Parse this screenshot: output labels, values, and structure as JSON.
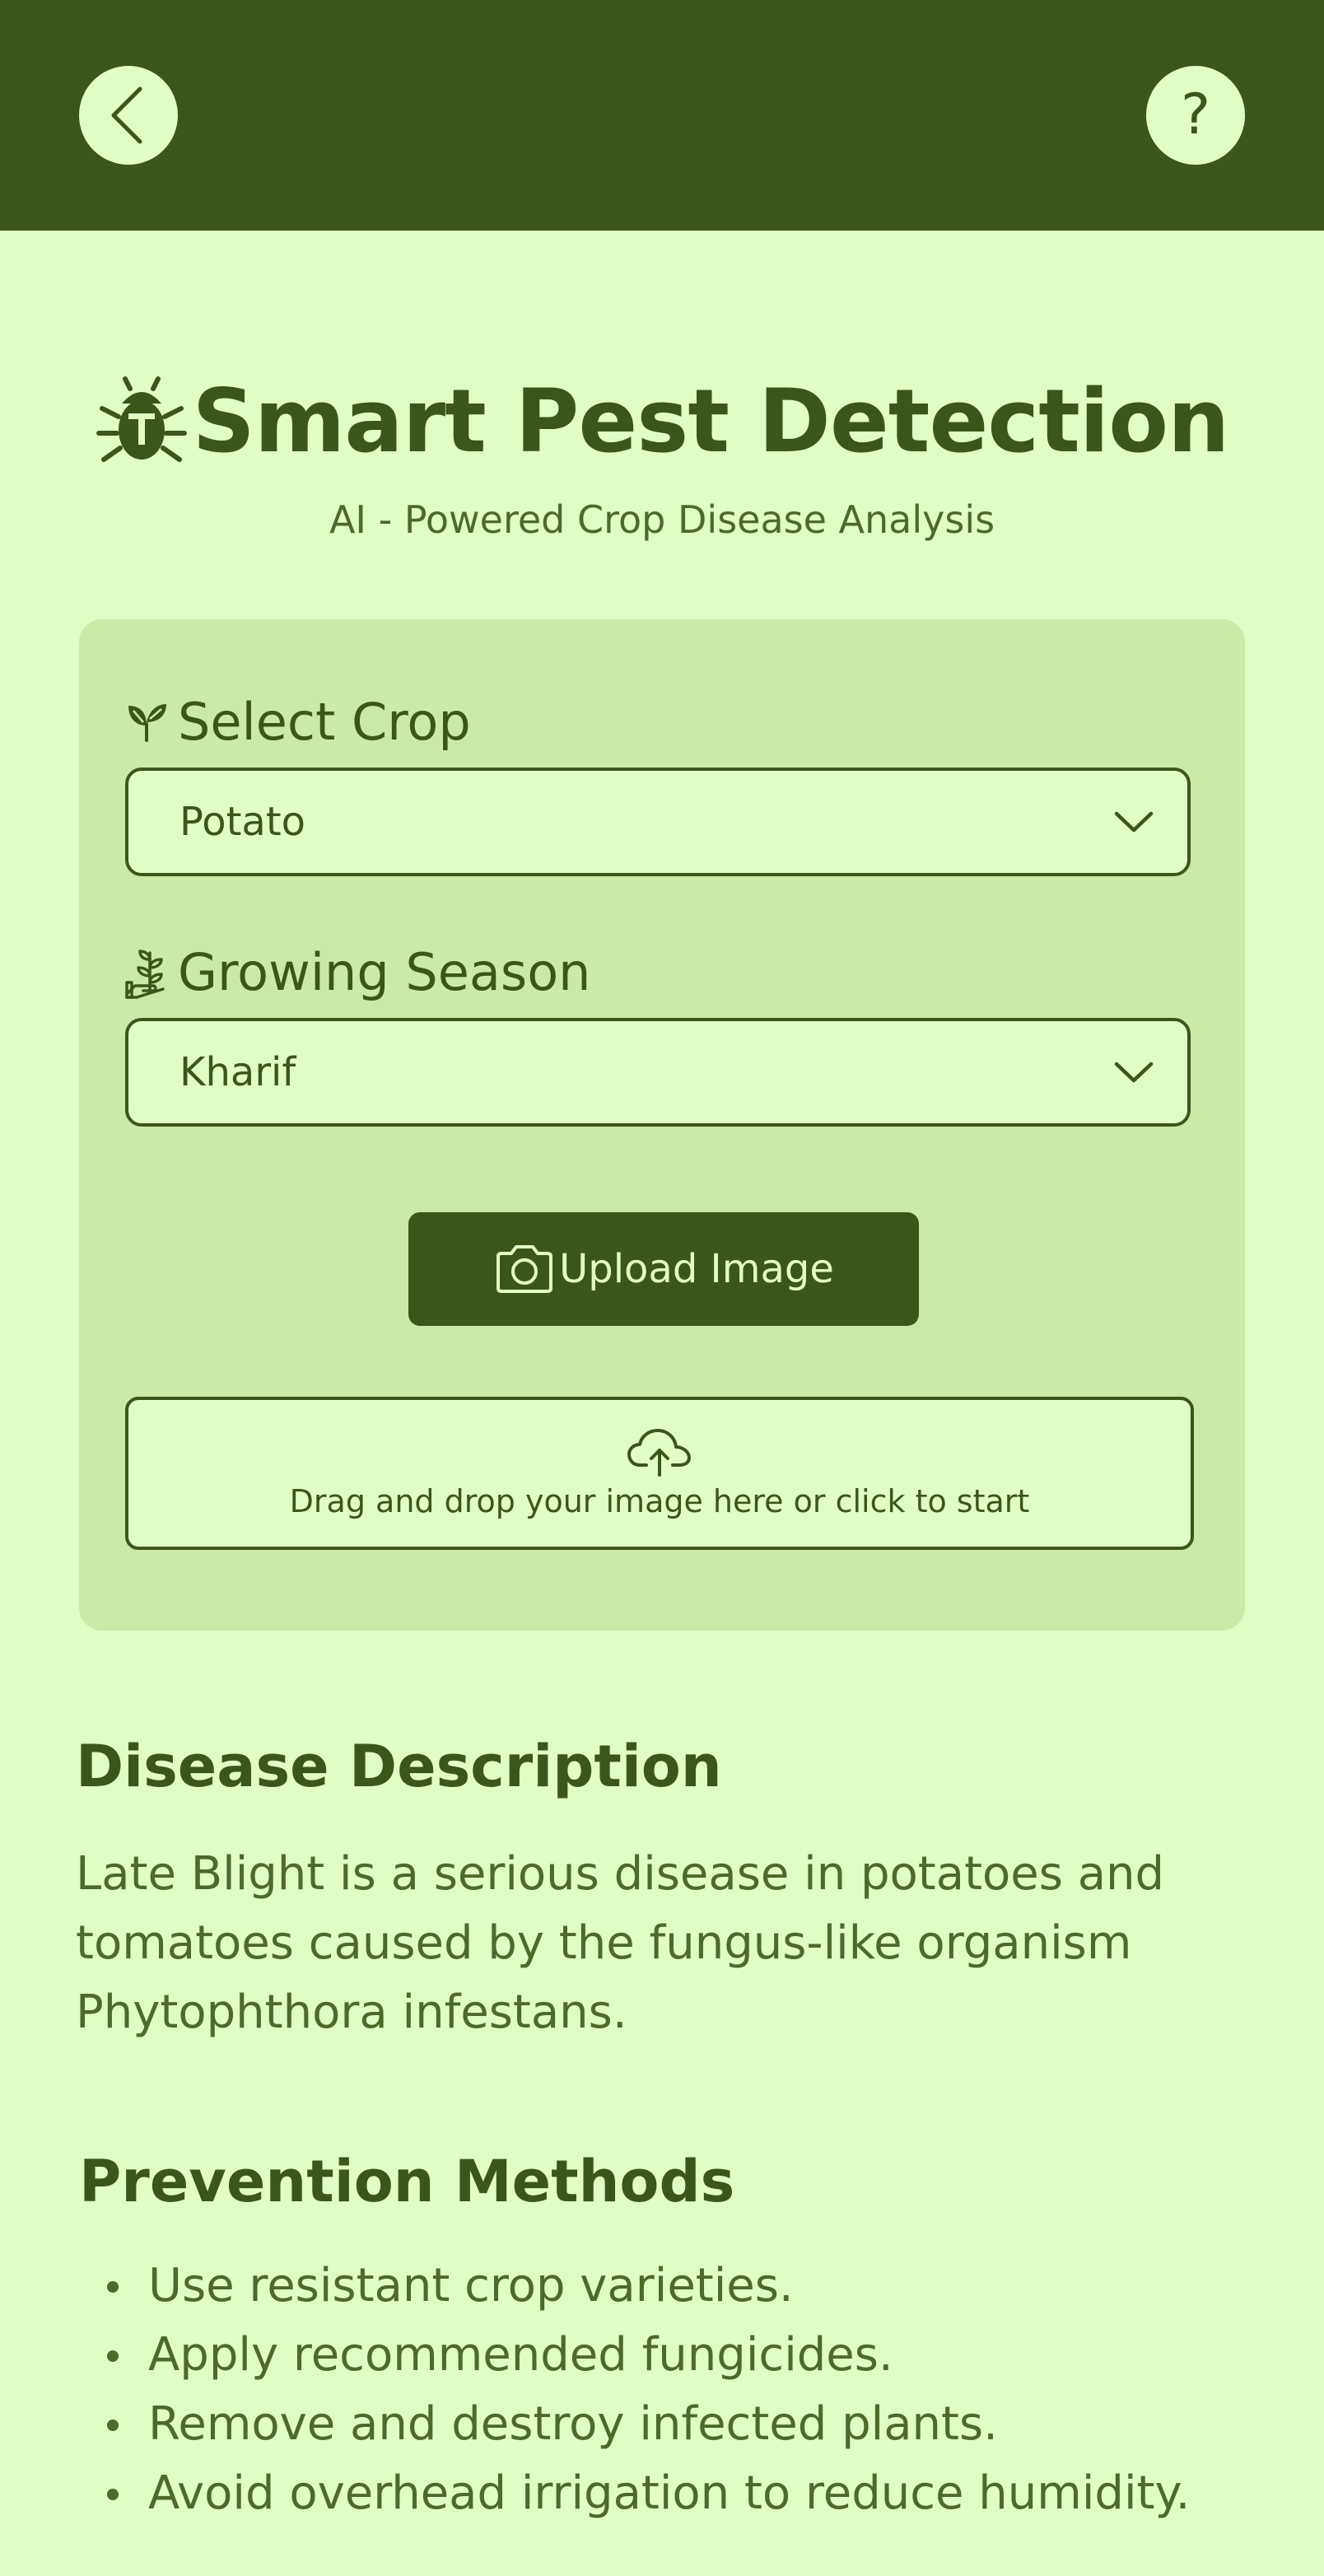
{
  "header": {
    "back_icon": "chevron-left-icon",
    "help_icon": "question-mark-icon",
    "help_glyph": "?"
  },
  "hero": {
    "icon": "bug-icon",
    "title": "Smart Pest Detection",
    "subtitle": "AI - Powered Crop Disease Analysis"
  },
  "form": {
    "crop": {
      "icon": "sprout-icon",
      "label": "Select Crop",
      "value": "Potato"
    },
    "season": {
      "icon": "plant-growth-icon",
      "label": "Growing Season",
      "value": "Kharif"
    },
    "upload_button": {
      "icon": "camera-icon",
      "label": "Upload Image"
    },
    "dropzone": {
      "icon": "cloud-upload-icon",
      "text": "Drag and drop your image here or click to start"
    }
  },
  "disease": {
    "heading": "Disease Description",
    "text": "Late Blight is a serious disease in potatoes and tomatoes caused by the fungus-like organism Phytophthora infestans."
  },
  "prevention": {
    "heading": "Prevention Methods",
    "items": [
      "Use resistant crop varieties.",
      "Apply recommended fungicides.",
      "Remove and destroy infected plants.",
      "Avoid overhead irrigation to reduce humidity."
    ]
  },
  "colors": {
    "primary_dark_green": "#3c561a",
    "background_light_green": "#e0fec4",
    "card_green": "#cbe9a7"
  }
}
